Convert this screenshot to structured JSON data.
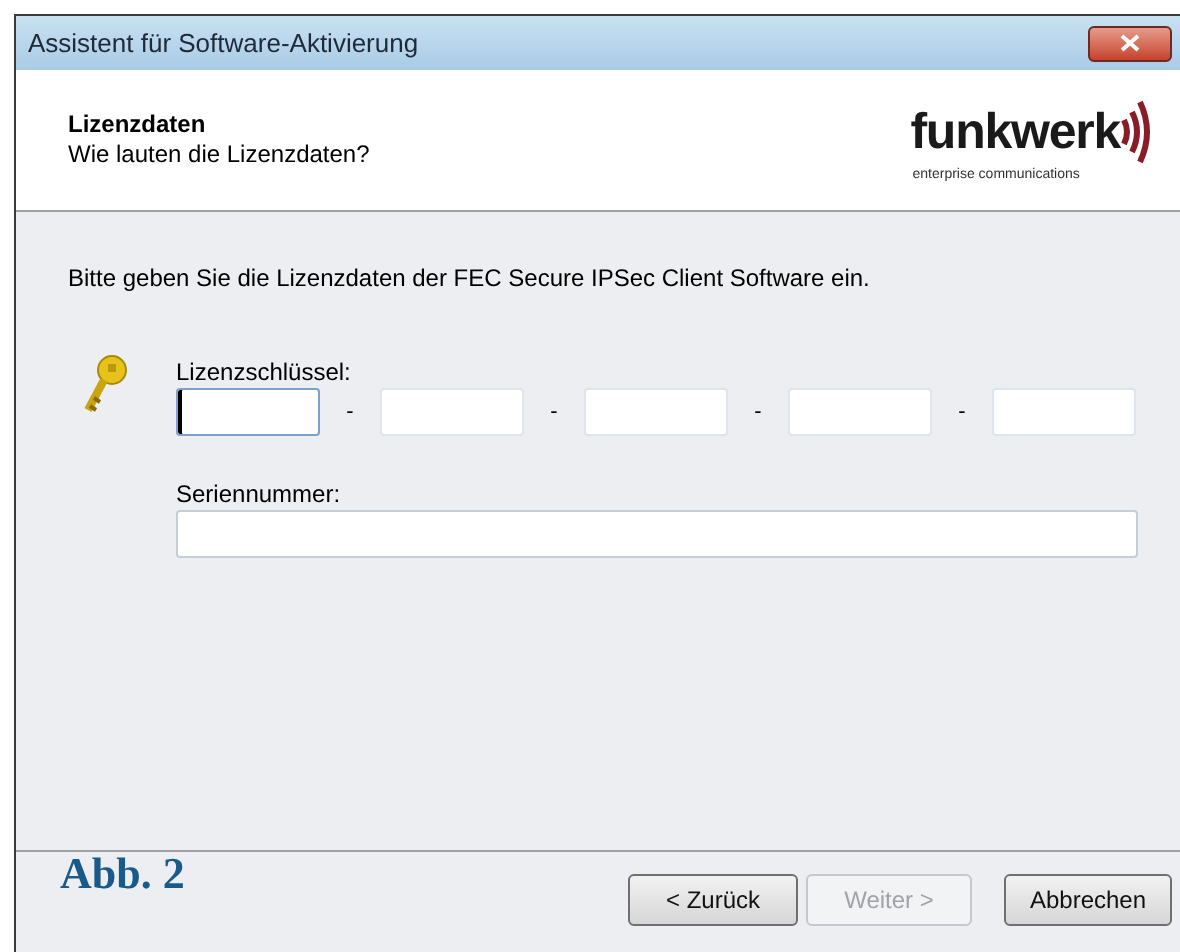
{
  "window": {
    "title": "Assistent für Software-Aktivierung"
  },
  "header": {
    "title": "Lizenzdaten",
    "subtitle": "Wie lauten die Lizenzdaten?",
    "logo": {
      "name": "funkwerk",
      "tagline": "enterprise communications"
    }
  },
  "intro": "Bitte geben Sie die Lizenzdaten der FEC Secure IPSec Client Software ein.",
  "license_key": {
    "label": "Lizenzschlüssel:",
    "separator": "-",
    "fields": [
      {
        "focused": true
      },
      {
        "focused": false
      },
      {
        "focused": false
      },
      {
        "focused": false
      },
      {
        "focused": false
      }
    ]
  },
  "serial_number": {
    "label": "Seriennummer:"
  },
  "figure_label": "Abb. 2",
  "buttons": [
    {
      "label": "< Zurück",
      "disabled": false
    },
    {
      "label": "Weiter >",
      "disabled": true
    },
    {
      "label": "Abbrechen",
      "disabled": false
    }
  ]
}
